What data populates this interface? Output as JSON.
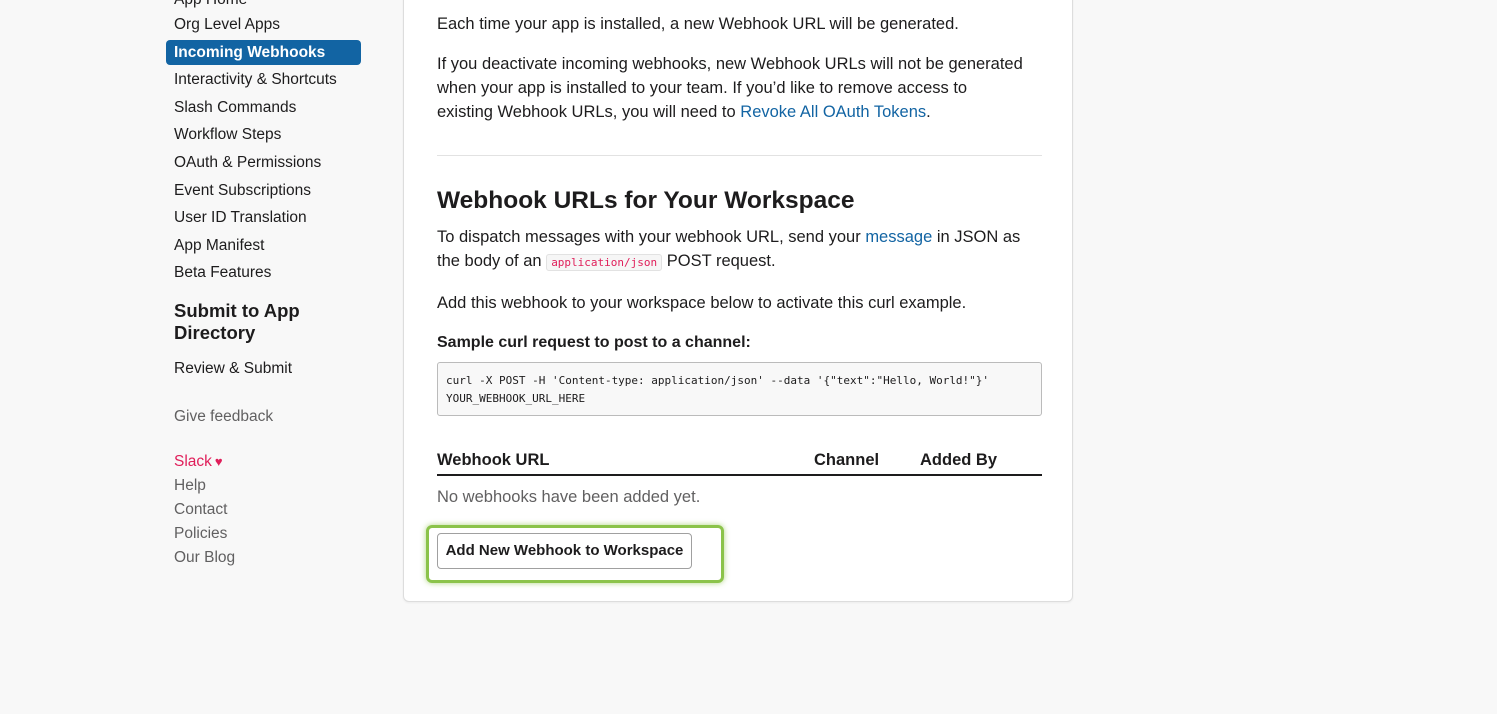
{
  "sidebar": {
    "partial_item": "App Home",
    "items": [
      {
        "label": "Org Level Apps"
      },
      {
        "label": "Incoming Webhooks",
        "active": true
      },
      {
        "label": "Interactivity & Shortcuts"
      },
      {
        "label": "Slash Commands"
      },
      {
        "label": "Workflow Steps"
      },
      {
        "label": "OAuth & Permissions"
      },
      {
        "label": "Event Subscriptions"
      },
      {
        "label": "User ID Translation"
      },
      {
        "label": "App Manifest"
      },
      {
        "label": "Beta Features"
      }
    ],
    "submit_section_title": "Submit to App Directory",
    "review_submit": "Review & Submit",
    "give_feedback": "Give feedback",
    "footer_links": {
      "slack": "Slack",
      "help": "Help",
      "contact": "Contact",
      "policies": "Policies",
      "blog": "Our Blog"
    }
  },
  "main": {
    "intro_text": "Each time your app is installed, a new Webhook URL will be generated.",
    "deactivate_text": "If you deactivate incoming webhooks, new Webhook URLs will not be generated when your app is installed to your team. If you’d like to remove access to existing Webhook URLs, you will need to",
    "revoke_link": "Revoke All OAuth Tokens",
    "period": ".",
    "section_title": "Webhook URLs for Your Workspace",
    "dispatch_text_1": "To dispatch messages with your webhook URL, send your",
    "message_link": "message",
    "dispatch_text_2": "in JSON as the body of an",
    "content_type_code": "application/json",
    "dispatch_text_3": "POST request.",
    "add_text": "Add this webhook to your workspace below to activate this curl example.",
    "sample_label": "Sample curl request to post to a channel:",
    "curl_code": "curl -X POST -H 'Content-type: application/json' --data '{\"text\":\"Hello, World!\"}' YOUR_WEBHOOK_URL_HERE",
    "table": {
      "columns": [
        "Webhook URL",
        "Channel",
        "Added By"
      ],
      "empty_message": "No webhooks have been added yet."
    },
    "add_button_label": "Add New Webhook to Workspace"
  },
  "colors": {
    "active_nav": "#1264a3",
    "link": "#1264a3",
    "slack_brand": "#e01e5a",
    "highlight": "#8bc34a"
  }
}
